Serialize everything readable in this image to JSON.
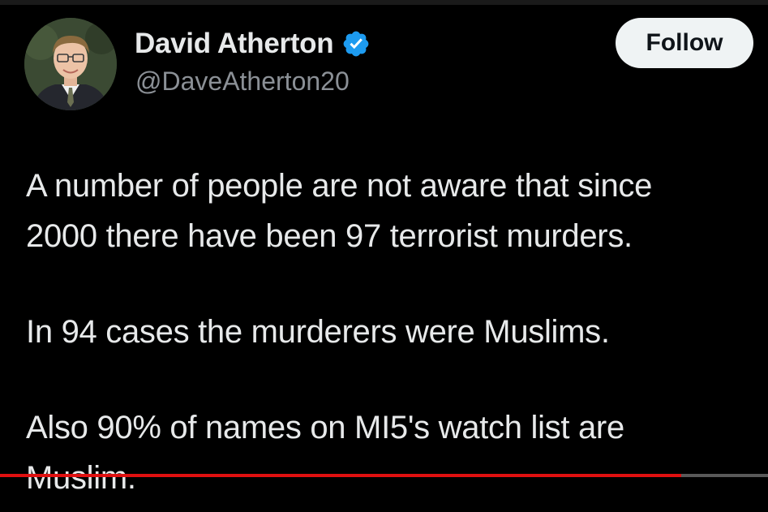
{
  "tweet": {
    "author": {
      "display_name": "David Atherton",
      "handle": "@DaveAtherton20",
      "verified": true,
      "verified_icon": "verified-badge-icon",
      "verified_color": "#1d9bf0"
    },
    "follow_label": "Follow",
    "text_lines": [
      "A number of people are not aware that since",
      "2000 there have been 97 terrorist murders.",
      "In 94 cases the murderers were Muslims.",
      "Also 90% of names on MI5's watch list are",
      "Muslim."
    ]
  },
  "video_player": {
    "progress_fraction": 0.887,
    "progress_color": "#e01010"
  }
}
